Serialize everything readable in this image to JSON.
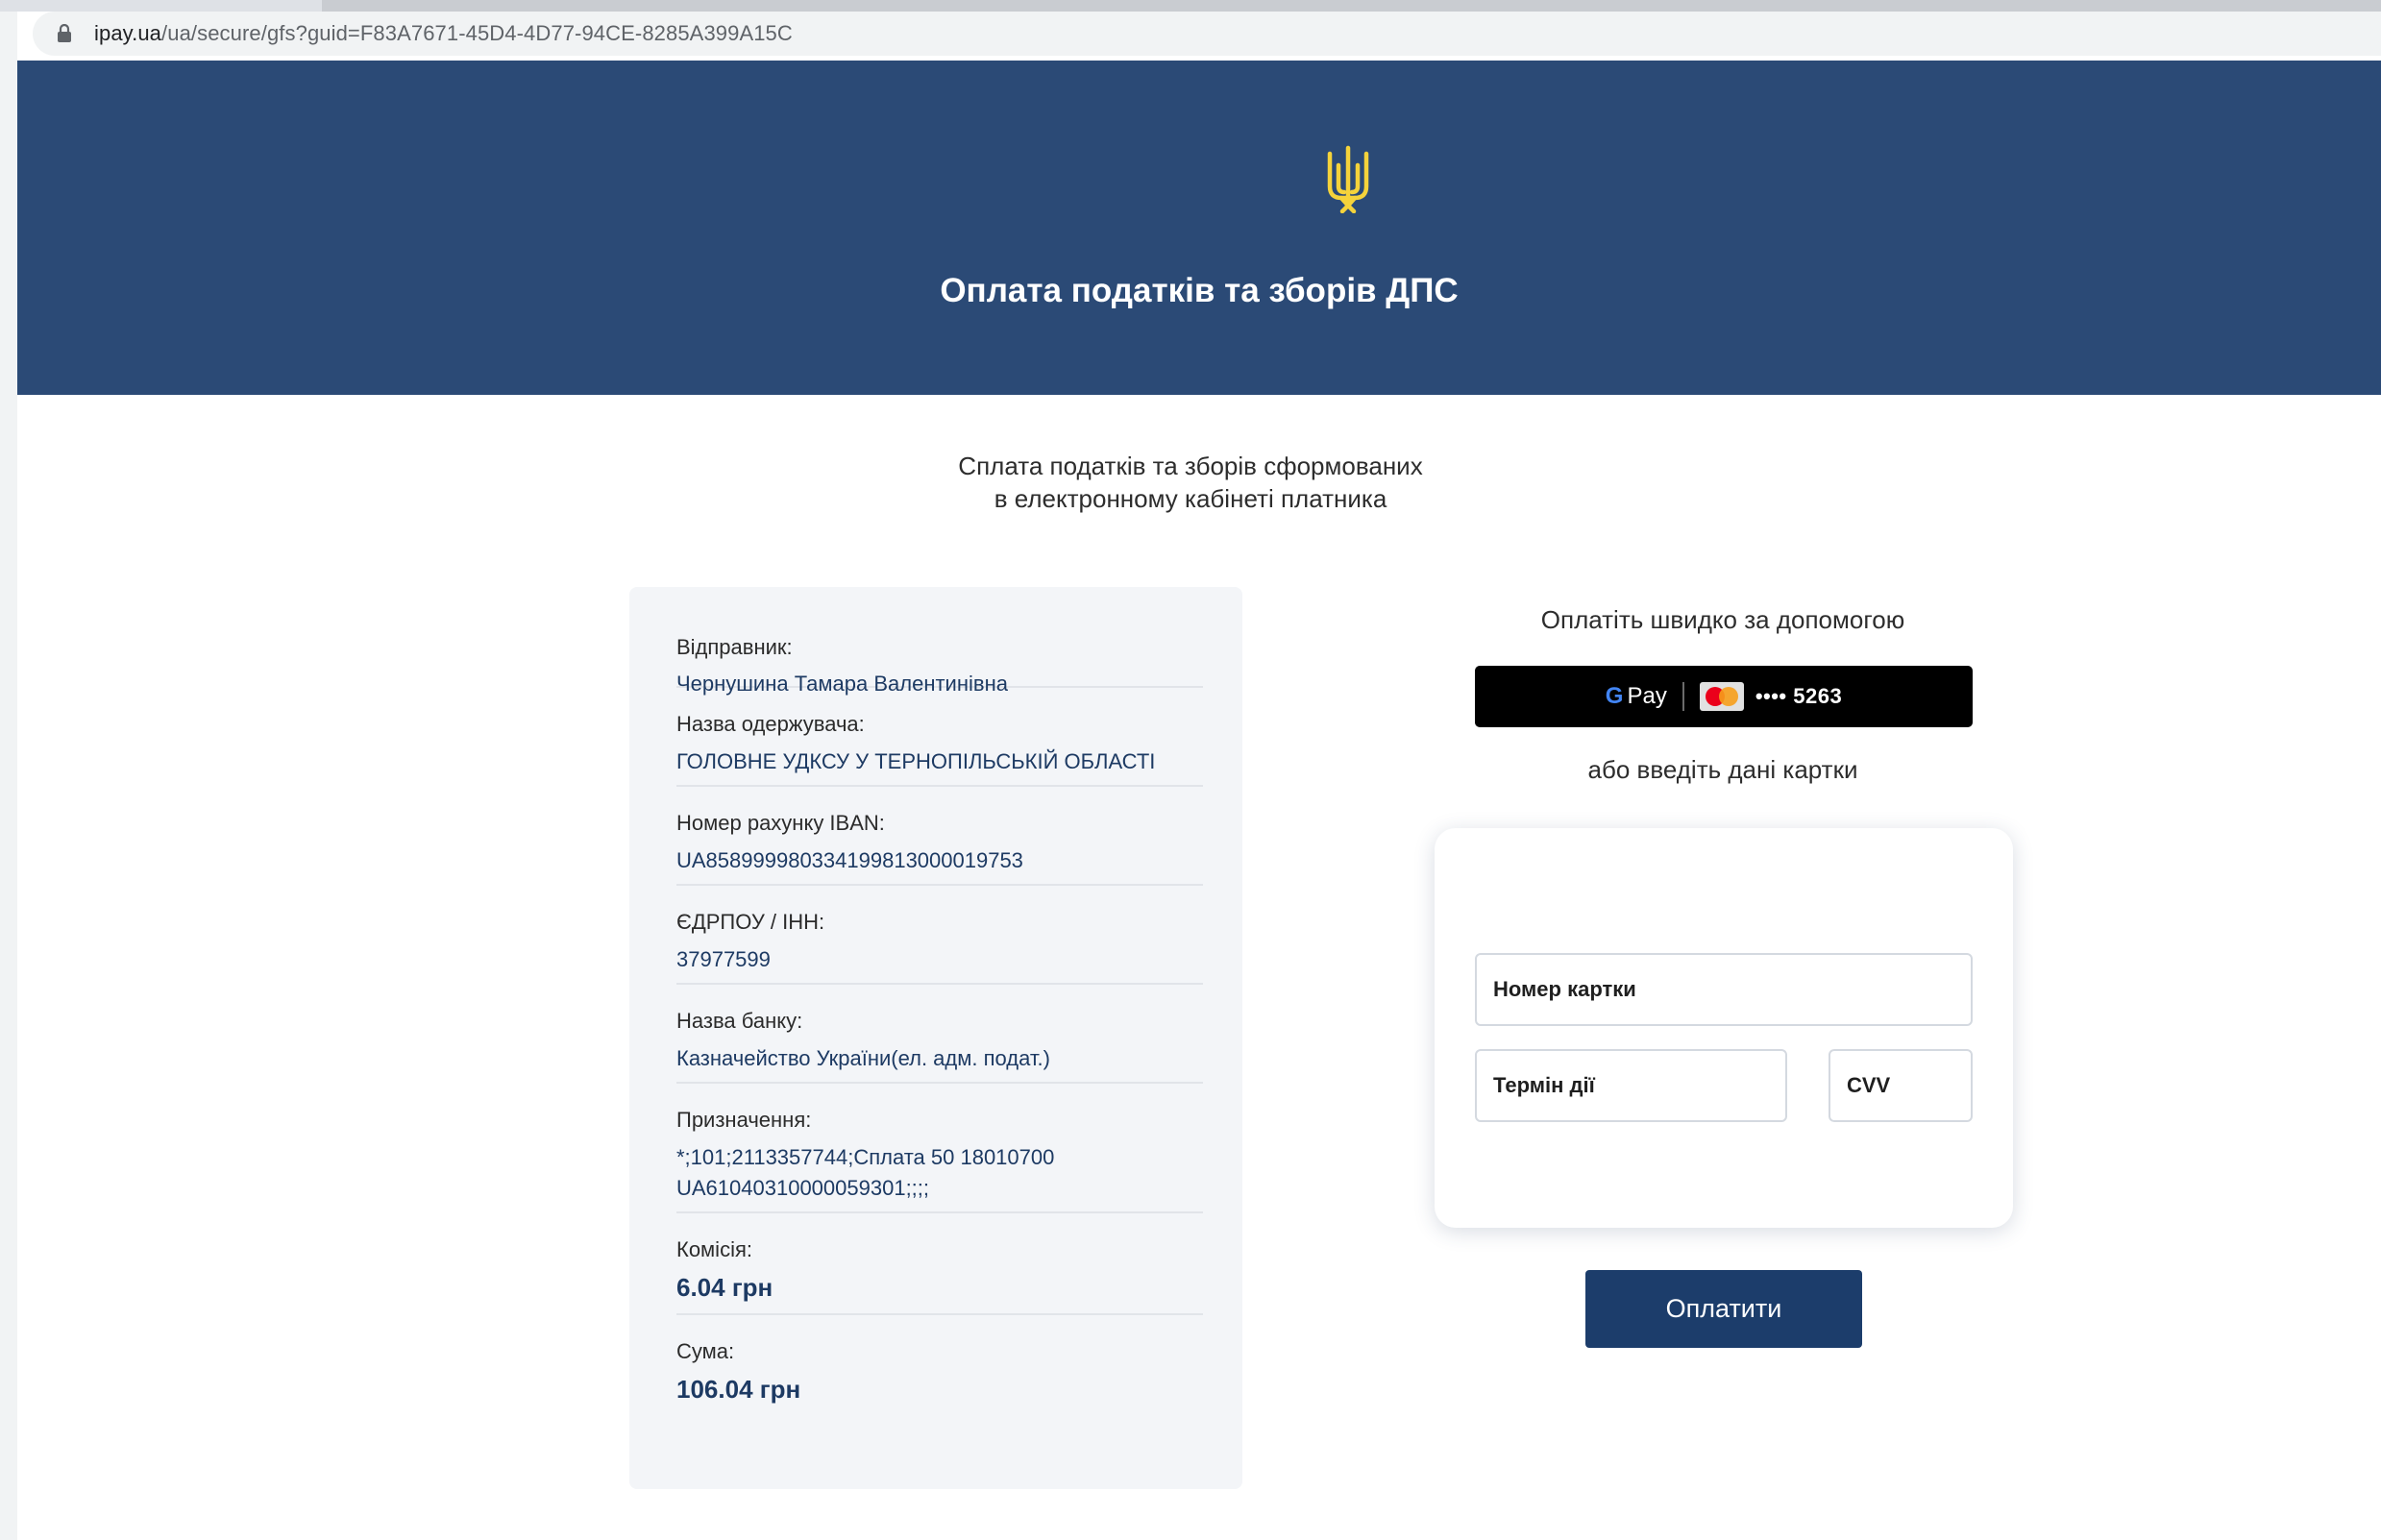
{
  "browser": {
    "url_host": "ipay.ua",
    "url_path": "/ua/secure/gfs?guid=F83A7671-45D4-4D77-94CE-8285A399A15C"
  },
  "header": {
    "title": "Оплата податків та зборів ДПС",
    "emblem_color": "#f5d33b",
    "background_color": "#2b4a76"
  },
  "subtitle": {
    "line1": "Сплата податків та зборів сформованих",
    "line2": "в електронному кабінеті платника"
  },
  "payment_info": {
    "sender_label": "Відправник:",
    "sender_value": "Чернушина Тамара Валентинівна",
    "recipient_label": "Назва одержувача:",
    "recipient_value": "ГОЛОВНЕ УДКСУ У ТЕРНОПІЛЬСЬКІЙ ОБЛАСТІ",
    "iban_label": "Номер рахунку IBAN:",
    "iban_value": "UA858999980334199813000019753",
    "edrpou_label": "ЄДРПОУ / ІНН:",
    "edrpou_value": "37977599",
    "bank_label": "Назва банку:",
    "bank_value": "Казначейство України(ел. адм. подат.)",
    "purpose_label": "Призначення:",
    "purpose_line1": "*;101;2113357744;Сплата 50 18010700",
    "purpose_line2": "UA61040310000059301;;;;",
    "commission_label": "Комісія:",
    "commission_value": "6.04 грн",
    "total_label": "Сума:",
    "total_value": "106.04 грн"
  },
  "quick_pay": {
    "text": "Оплатіть швидко за допомогою",
    "gpay_g": "G",
    "gpay_pay": "Pay",
    "card_mask": "•••• 5263",
    "or_text": "або введіть дані картки"
  },
  "card_form": {
    "card_number_placeholder": "Номер картки",
    "expiry_placeholder": "Термін дії",
    "cvv_placeholder": "CVV"
  },
  "pay_button_label": "Оплатити"
}
